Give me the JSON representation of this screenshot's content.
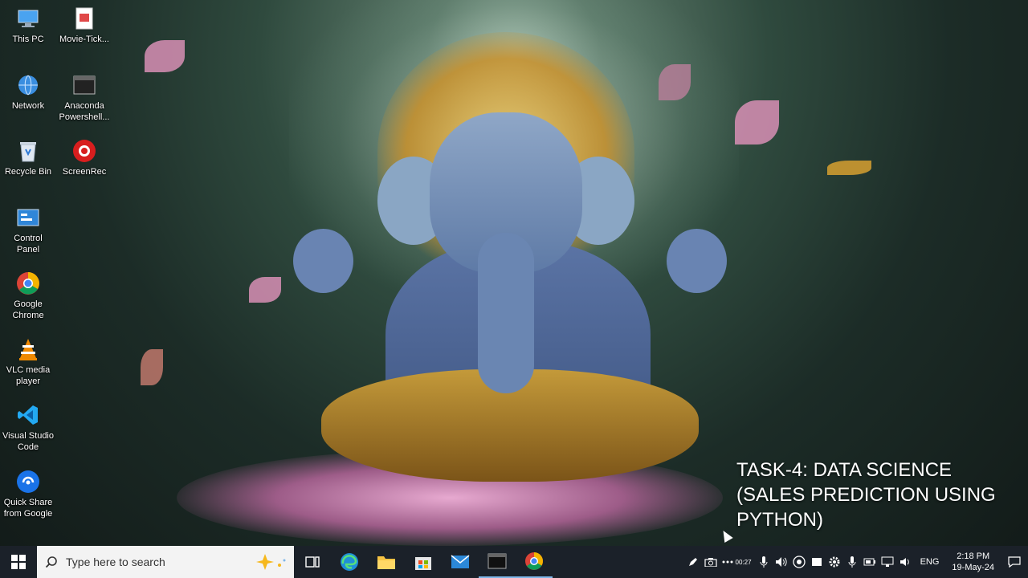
{
  "desktop": {
    "icons": [
      {
        "label": "This PC",
        "icon": "this-pc-icon"
      },
      {
        "label": "Movie-Tick...",
        "icon": "document-icon"
      },
      {
        "label": "Network",
        "icon": "network-icon"
      },
      {
        "label": "Anaconda\nPowershell...",
        "icon": "terminal-icon"
      },
      {
        "label": "Recycle Bin",
        "icon": "recycle-bin-icon"
      },
      {
        "label": "ScreenRec",
        "icon": "screenrec-icon"
      },
      {
        "label": "Control\nPanel",
        "icon": "control-panel-icon"
      },
      {
        "label": "Google\nChrome",
        "icon": "chrome-icon"
      },
      {
        "label": "VLC media\nplayer",
        "icon": "vlc-icon"
      },
      {
        "label": "Visual Studio\nCode",
        "icon": "vscode-icon"
      },
      {
        "label": "Quick Share\nfrom Google",
        "icon": "quick-share-icon"
      }
    ]
  },
  "caption": {
    "text": "TASK-4: DATA SCIENCE (SALES PREDICTION USING PYTHON)"
  },
  "taskbar": {
    "search_placeholder": "Type here to search",
    "pinned": [
      "task-view-icon",
      "edge-icon",
      "file-explorer-icon",
      "store-icon",
      "mail-icon",
      "terminal-icon",
      "chrome-icon"
    ],
    "tray": {
      "recording_time": "00:27",
      "language": "ENG",
      "time": "2:18 PM",
      "date": "19-May-24"
    }
  },
  "colors": {
    "taskbar_bg": "#1b2129",
    "accent": "#7fb6e8"
  }
}
